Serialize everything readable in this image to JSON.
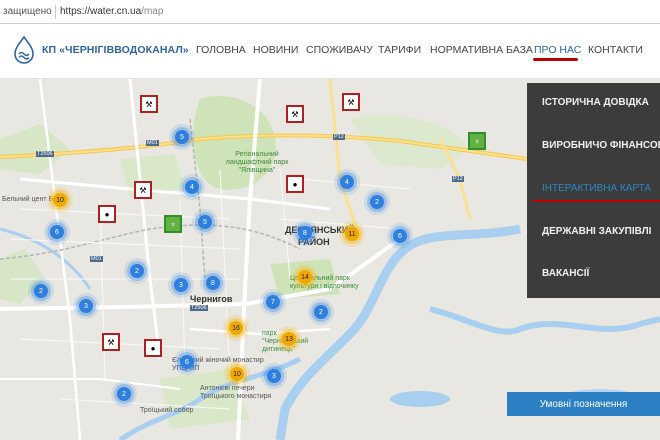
{
  "browser": {
    "secure_label": "защищено",
    "url_host": "https://water.cn.ua",
    "url_path": "/map"
  },
  "header": {
    "brand": "КП «ЧЕРНІГІВВОДОКАНАЛ»",
    "nav": [
      "ГОЛОВНА",
      "НОВИНИ",
      "СПОЖИВАЧУ",
      "ТАРИФИ",
      "НОРМАТИВНА БАЗА",
      "ПРО НАС",
      "КОНТАКТИ"
    ],
    "active_nav": "ПРО НАС"
  },
  "dropdown": {
    "items": [
      "ІСТОРИЧНА ДОВІДКА",
      "ВИРОБНИЧО ФІНАНСОВІ П",
      "ІНТЕРАКТИВНА КАРТА",
      "ДЕРЖАВНІ ЗАКУПІВЛІ",
      "ВАКАНСІЇ"
    ],
    "active_item": "ІНТЕРАКТИВНА КАРТА"
  },
  "map": {
    "legend_button": "Умовні позначення",
    "labels": {
      "city": "Чернигов",
      "district1": "ДЕСНЯНСЬКИЙ",
      "district2": "РАЙОН",
      "park1": "Регіональний ландшафтний парк \"Ялівщина\"",
      "park2": "Центральний парк культури і відпочинку",
      "ditynets": "парк \"Чернігівський дитинець\"",
      "monastery": "Єлецький жіночий монастир УПЦ МП",
      "pechery": "Антонієві печери Троїцького монастиря",
      "sobor": "Троїцький собор",
      "center": "Бельний цент Базис"
    },
    "clusters": [
      {
        "n": "5",
        "yellow": false
      },
      {
        "n": "4",
        "yellow": false
      },
      {
        "n": "4",
        "yellow": false
      },
      {
        "n": "2",
        "yellow": false
      },
      {
        "n": "10",
        "yellow": true
      },
      {
        "n": "6",
        "yellow": false
      },
      {
        "n": "5",
        "yellow": false
      },
      {
        "n": "8",
        "yellow": false
      },
      {
        "n": "11",
        "yellow": true
      },
      {
        "n": "6",
        "yellow": false
      },
      {
        "n": "2",
        "yellow": false
      },
      {
        "n": "8",
        "yellow": false
      },
      {
        "n": "3",
        "yellow": false
      },
      {
        "n": "2",
        "yellow": false
      },
      {
        "n": "14",
        "yellow": true
      },
      {
        "n": "7",
        "yellow": false
      },
      {
        "n": "3",
        "yellow": false
      },
      {
        "n": "16",
        "yellow": true
      },
      {
        "n": "13",
        "yellow": true
      },
      {
        "n": "6",
        "yellow": false
      },
      {
        "n": "10",
        "yellow": true
      },
      {
        "n": "2",
        "yellow": false
      },
      {
        "n": "3",
        "yellow": false
      },
      {
        "n": "2",
        "yellow": false
      }
    ],
    "roads": [
      "M01",
      "P12",
      "P12",
      "T2506",
      "M01",
      "T2506"
    ]
  }
}
